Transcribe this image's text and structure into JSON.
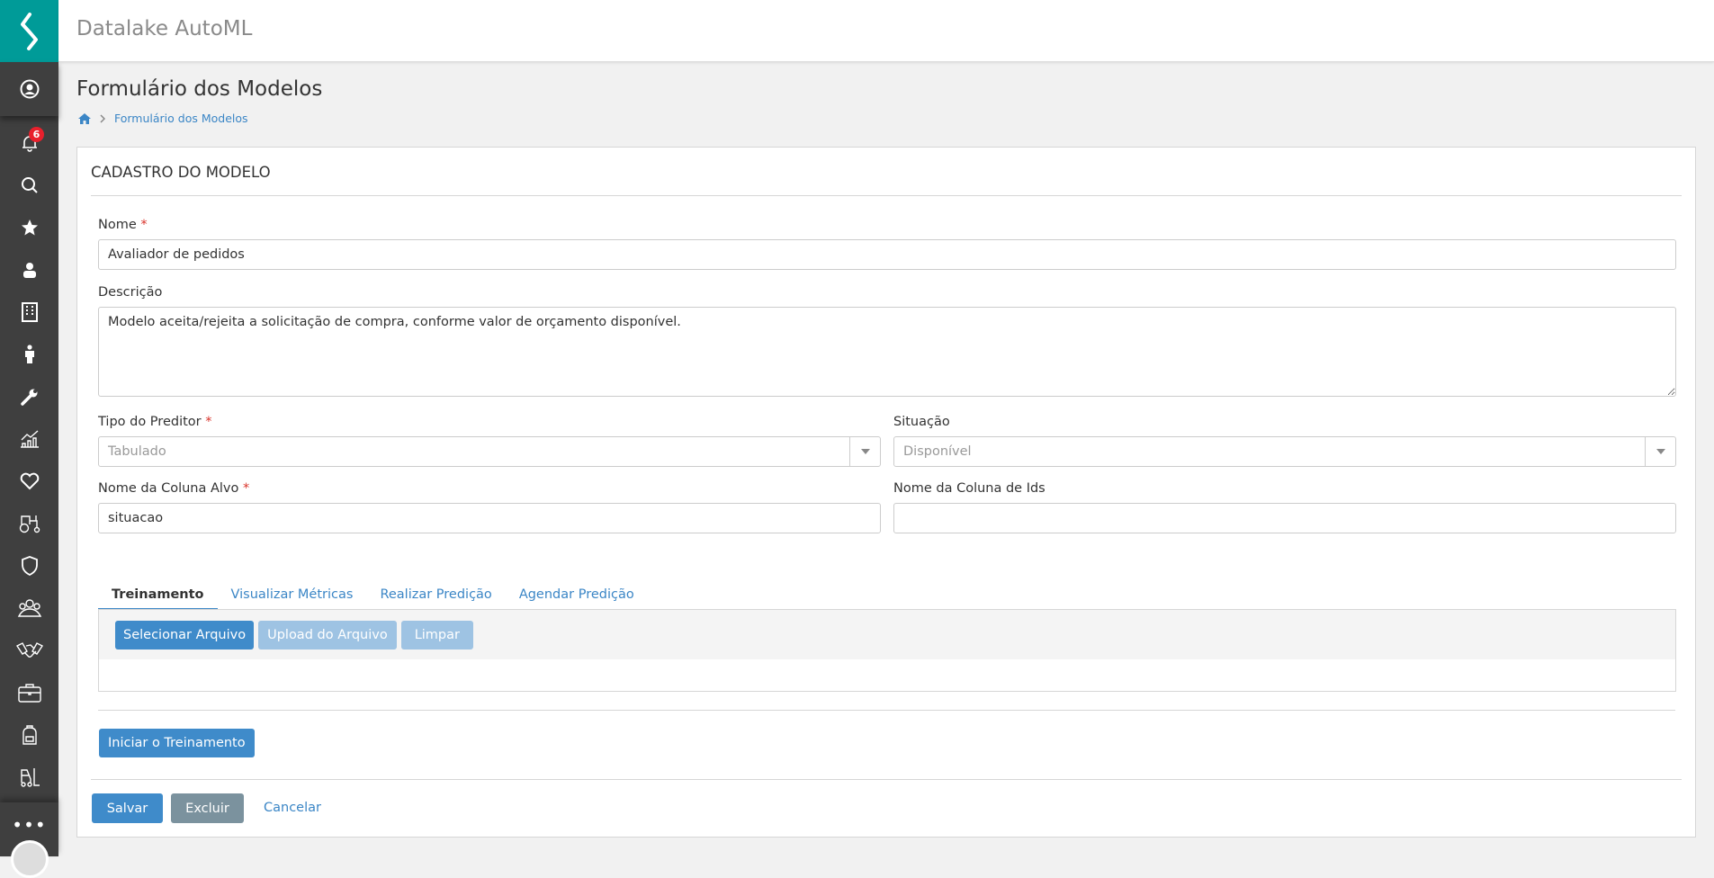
{
  "app": {
    "title": "Datalake AutoML"
  },
  "sidebar": {
    "notification_count": "6",
    "items": [
      "user-circle",
      "bell",
      "search",
      "star",
      "user",
      "building",
      "person",
      "wrench",
      "chart",
      "heart",
      "tractor",
      "shield",
      "team",
      "handshake",
      "briefcase",
      "backpack",
      "forklift"
    ],
    "more": "•••"
  },
  "page": {
    "title": "Formulário dos Modelos",
    "breadcrumb": "Formulário dos Modelos"
  },
  "form": {
    "section_title": "CADASTRO DO MODELO",
    "nome": {
      "label": "Nome",
      "required": "*",
      "value": "Avaliador de pedidos"
    },
    "descricao": {
      "label": "Descrição",
      "value": "Modelo aceita/rejeita a solicitação de compra, conforme valor de orçamento disponível."
    },
    "tipo": {
      "label": "Tipo do Preditor",
      "required": "*",
      "value": "Tabulado"
    },
    "situacao": {
      "label": "Situação",
      "value": "Disponível"
    },
    "coluna_alvo": {
      "label": "Nome da Coluna Alvo",
      "required": "*",
      "value": "situacao"
    },
    "coluna_ids": {
      "label": "Nome da Coluna de Ids",
      "value": ""
    }
  },
  "tabs": [
    "Treinamento",
    "Visualizar Métricas",
    "Realizar Predição",
    "Agendar Predição"
  ],
  "upload": {
    "select": "Selecionar Arquivo",
    "upload": "Upload do Arquivo",
    "clear": "Limpar"
  },
  "actions": {
    "train": "Iniciar o Treinamento",
    "save": "Salvar",
    "delete": "Excluir",
    "cancel": "Cancelar"
  }
}
